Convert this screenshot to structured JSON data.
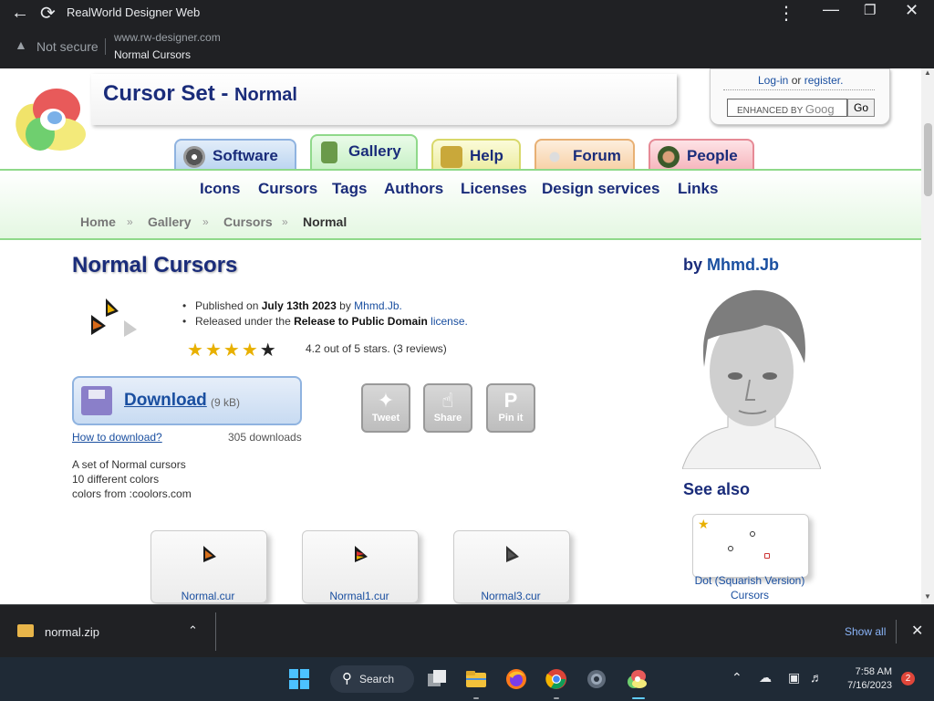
{
  "browser": {
    "app_title": "RealWorld Designer Web",
    "security_label": "Not secure",
    "domain": "www.rw-designer.com",
    "page_title": "Normal Cursors"
  },
  "header": {
    "site_title": "Cursor Set -",
    "site_subtitle": "Normal",
    "login_link": "Log-in",
    "or_text": "or",
    "register_link": "register.",
    "search_placeholder": "ENHANCED BY",
    "search_brand": "Goog",
    "go_label": "Go"
  },
  "tabs": [
    {
      "label": "Software"
    },
    {
      "label": "Gallery"
    },
    {
      "label": "Help"
    },
    {
      "label": "Forum"
    },
    {
      "label": "People"
    }
  ],
  "nav": [
    "Icons",
    "Cursors",
    "Tags",
    "Authors",
    "Licenses",
    "Design services",
    "Links"
  ],
  "breadcrumb": [
    "Home",
    "Gallery",
    "Cursors",
    "Normal"
  ],
  "content": {
    "heading": "Normal Cursors",
    "published_prefix": "Published on",
    "published_date": "July 13th 2023",
    "by_text": "by",
    "author": "Mhmd.Jb.",
    "released_prefix": "Released under the",
    "license_name": "Release to Public Domain",
    "license_link": "license.",
    "rating_value": 4.2,
    "rating_text": "4.2 out of 5 stars. (3 reviews)",
    "download_label": "Download",
    "download_size": "(9 kB)",
    "howto_link": "How to download?",
    "download_count": "305 downloads",
    "share": [
      {
        "label": "Tweet",
        "icon": "twitter-bird-icon"
      },
      {
        "label": "Share",
        "icon": "thumbs-up-icon"
      },
      {
        "label": "Pin it",
        "icon": "pinterest-icon"
      }
    ],
    "description": [
      "A set of Normal cursors",
      "10 different colors",
      "colors from :coolors.com"
    ],
    "files": [
      "Normal.cur",
      "Normal1.cur",
      "Normal3.cur"
    ]
  },
  "sidebar": {
    "by_label": "by",
    "author": "Mhmd.Jb",
    "see_also": "See also",
    "related_name": "Dot (Squarish Version) Cursors"
  },
  "download_bar": {
    "file_name": "normal.zip",
    "show_all": "Show all"
  },
  "taskbar": {
    "search_label": "Search",
    "time": "7:58 AM",
    "date": "7/16/2023",
    "notification_count": "2"
  },
  "colors": {
    "brand_navy": "#1a2c7a",
    "link_blue": "#1a4fa0",
    "gallery_green": "#8fd98a"
  }
}
